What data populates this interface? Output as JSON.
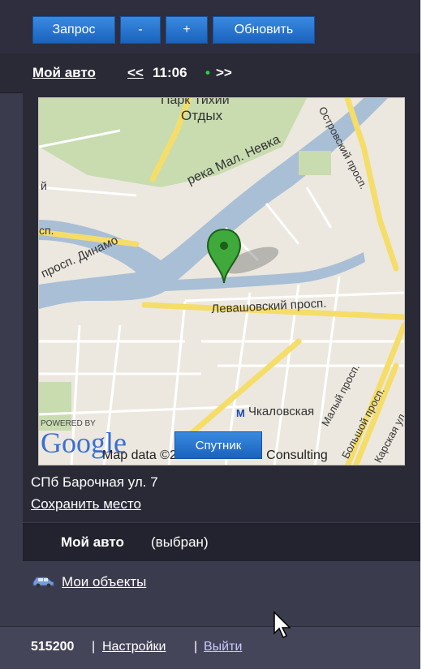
{
  "toolbar": {
    "query_label": "Запрос",
    "minus_label": "-",
    "plus_label": "+",
    "refresh_label": "Обновить"
  },
  "header": {
    "car_name": "Мой авто",
    "prev_label": "<<",
    "time": "11:06",
    "dot": "•",
    "next_label": ">>"
  },
  "map": {
    "labels": {
      "park": "Парк Тихий",
      "park2": "Отдых",
      "river": "река Мал. Невка",
      "avenue_dinamo": "просп. Динамо",
      "levashovsky": "Левашовский просп.",
      "ostrovsky": "Островский просп.",
      "maly": "Малый просп.",
      "bolshoy": "Большой просп.",
      "karsk": "Карская ул.",
      "chkalovskaya": "Чкаловская",
      "metro_symbol": "М",
      "sp_left": "сп.",
      "ya": "й",
      "powered_by": "POWERED BY",
      "google": "Google",
      "attribution": "Map data ©2010 Geocentre Consulting"
    },
    "satellite_label": "Спутник"
  },
  "location": {
    "address": "СПб Барочная ул. 7",
    "save_label": "Сохранить место"
  },
  "selected": {
    "name": "Мой авто",
    "state": "(выбран)"
  },
  "objects": {
    "label": "Мои объекты",
    "icon": "car-icon"
  },
  "footer": {
    "account_id": "515200",
    "separator": "|",
    "settings_label": "Настройки",
    "logout_label": "Выйти"
  },
  "colors": {
    "accent_button": "#2a73cf",
    "panel": "#3b3b4e",
    "dark_panel": "#2a2a37"
  }
}
